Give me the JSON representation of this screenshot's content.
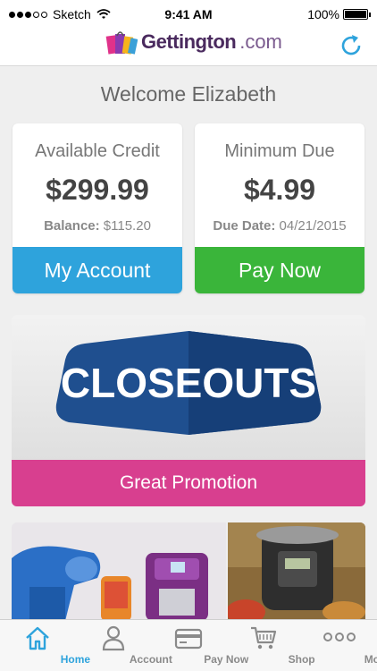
{
  "status_bar": {
    "carrier": "Sketch",
    "time": "9:41 AM",
    "battery": "100%"
  },
  "header": {
    "brand": "Gettington",
    "brand_suffix": ".com"
  },
  "welcome": "Welcome Elizabeth",
  "credit_card": {
    "title": "Available Credit",
    "amount": "$299.99",
    "sub_label": "Balance:",
    "sub_value": "$115.20",
    "button": "My Account"
  },
  "due_card": {
    "title": "Minimum Due",
    "amount": "$4.99",
    "sub_label": "Due Date:",
    "sub_value": "04/21/2015",
    "button": "Pay Now"
  },
  "promo": {
    "logo_text": "CLOSEOUTS",
    "button": "Great Promotion"
  },
  "tabs": [
    {
      "label": "Home",
      "icon": "home-icon"
    },
    {
      "label": "Account",
      "icon": "person-icon"
    },
    {
      "label": "Pay Now",
      "icon": "card-icon"
    },
    {
      "label": "Shop",
      "icon": "cart-icon"
    },
    {
      "label": "More",
      "icon": "more-icon"
    }
  ],
  "colors": {
    "accent_blue": "#2ea3dc",
    "green": "#3ab53a",
    "pink": "#d83f8f",
    "closeouts_blue": "#1f4f8f"
  }
}
